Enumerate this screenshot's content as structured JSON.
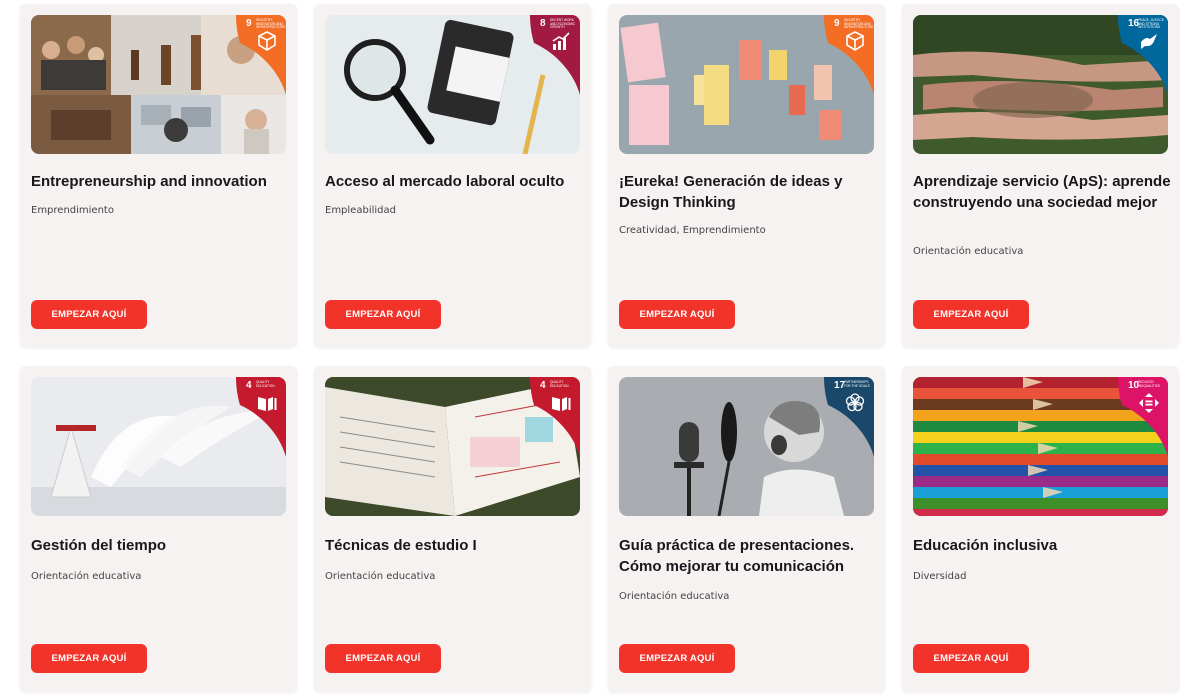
{
  "cards": [
    {
      "title": "Entrepreneurship and innovation",
      "category": "Emprendimiento",
      "button": "EMPEZAR AQUÍ",
      "sdg": {
        "num": "9",
        "label": "INDUSTRY, INNOVATION AND INFRASTRUCTURE",
        "color": "#f36d25",
        "icon": "cube-icon"
      }
    },
    {
      "title": "Acceso al mercado laboral oculto",
      "category": "Empleabilidad",
      "button": "EMPEZAR AQUÍ",
      "sdg": {
        "num": "8",
        "label": "DECENT WORK AND ECONOMIC GROWTH",
        "color": "#a21942",
        "icon": "growth-chart-icon"
      }
    },
    {
      "title": "¡Eureka! Generación de ideas y Design Thinking",
      "category": "Creatividad, Emprendimiento",
      "button": "EMPEZAR AQUÍ",
      "sdg": {
        "num": "9",
        "label": "INDUSTRY, INNOVATION AND INFRASTRUCTURE",
        "color": "#f36d25",
        "icon": "cube-icon"
      }
    },
    {
      "title": "Aprendizaje servicio (ApS): aprende construyendo una sociedad mejor",
      "category": "Orientación educativa",
      "button": "EMPEZAR AQUÍ",
      "sdg": {
        "num": "16",
        "label": "PEACE, JUSTICE AND STRONG INSTITUTIONS",
        "color": "#00689d",
        "icon": "dove-icon"
      }
    },
    {
      "title": "Gestión del tiempo",
      "category": "Orientación educativa",
      "button": "EMPEZAR AQUÍ",
      "sdg": {
        "num": "4",
        "label": "QUALITY EDUCATION",
        "color": "#c5192d",
        "icon": "book-icon"
      }
    },
    {
      "title": "Técnicas de estudio I",
      "category": "Orientación educativa",
      "button": "EMPEZAR AQUÍ",
      "sdg": {
        "num": "4",
        "label": "QUALITY EDUCATION",
        "color": "#c5192d",
        "icon": "book-icon"
      }
    },
    {
      "title": "Guía práctica de presentaciones. Cómo mejorar tu comunicación",
      "category": "Orientación educativa",
      "button": "EMPEZAR AQUÍ",
      "sdg": {
        "num": "17",
        "label": "PARTNERSHIPS FOR THE GOALS",
        "color": "#19486a",
        "icon": "flower-icon"
      }
    },
    {
      "title": "Educación inclusiva",
      "category": "Diversidad",
      "button": "EMPEZAR AQUÍ",
      "sdg": {
        "num": "10",
        "label": "REDUCED INEQUALITIES",
        "color": "#dd1367",
        "icon": "equality-arrows-icon"
      }
    }
  ]
}
